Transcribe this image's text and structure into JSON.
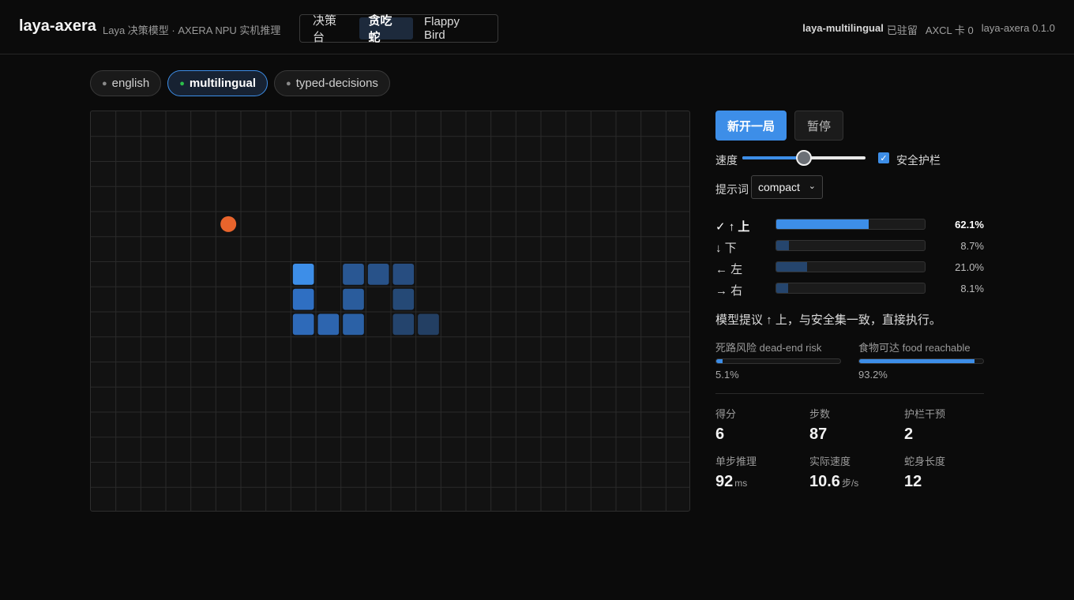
{
  "header": {
    "brand": "laya-axera",
    "subtitle": "Laya 决策模型 · AXERA NPU 实机推理",
    "tabs": [
      {
        "label": "决策台",
        "active": false
      },
      {
        "label": "贪吃蛇",
        "active": true
      },
      {
        "label": "Flappy Bird",
        "active": false
      }
    ],
    "status": {
      "model": "laya-multilingual",
      "model_state": "已驻留",
      "card": "AXCL 卡 0",
      "version": "laya-axera 0.1.0"
    }
  },
  "models": [
    {
      "label": "english",
      "active": false
    },
    {
      "label": "multilingual",
      "active": true
    },
    {
      "label": "typed-decisions",
      "active": false
    }
  ],
  "board": {
    "cols": 24,
    "rows": 16,
    "food": {
      "col": 5,
      "row": 4
    },
    "head": {
      "col": 8,
      "row": 6
    },
    "body": [
      {
        "col": 8,
        "row": 7
      },
      {
        "col": 8,
        "row": 8
      },
      {
        "col": 9,
        "row": 8
      },
      {
        "col": 10,
        "row": 8
      },
      {
        "col": 10,
        "row": 7
      },
      {
        "col": 10,
        "row": 6
      },
      {
        "col": 11,
        "row": 6
      },
      {
        "col": 12,
        "row": 6
      },
      {
        "col": 12,
        "row": 7
      },
      {
        "col": 12,
        "row": 8
      },
      {
        "col": 13,
        "row": 8
      }
    ],
    "colors": {
      "background": "#121212",
      "grid": "#2a2a2a",
      "food": "#e8642c",
      "head": "#3d8ee8",
      "body_near": "#2f6fc2",
      "body_far": "#233f63"
    }
  },
  "controls": {
    "new_game_label": "新开一局",
    "pause_label": "暂停",
    "speed_label": "速度",
    "speed_value": 0.5,
    "guard_label": "安全护栏",
    "guard_checked": true,
    "prompt_label": "提示词",
    "prompt_value": "compact"
  },
  "probabilities": [
    {
      "label": "✓ ↑ 上",
      "value": 0.621,
      "display": "62.1%",
      "best": true
    },
    {
      "label": "↓ 下",
      "value": 0.087,
      "display": "8.7%",
      "best": false
    },
    {
      "label": "← 左",
      "value": 0.21,
      "display": "21.0%",
      "best": false
    },
    {
      "label": "→ 右",
      "value": 0.081,
      "display": "8.1%",
      "best": false
    }
  ],
  "suggestion": "模型提议 ↑ 上，与安全集一致，直接执行。",
  "meters": {
    "deadend": {
      "label": "死路风险 dead-end risk",
      "value": 0.051,
      "display": "5.1%"
    },
    "food": {
      "label": "食物可达 food reachable",
      "value": 0.932,
      "display": "93.2%"
    }
  },
  "stats": {
    "score": {
      "label": "得分",
      "value": "6"
    },
    "steps": {
      "label": "步数",
      "value": "87"
    },
    "interventions": {
      "label": "护栏干预",
      "value": "2"
    },
    "latency": {
      "label": "单步推理",
      "value": "92",
      "unit": "ms"
    },
    "speed": {
      "label": "实际速度",
      "value": "10.6",
      "unit": "步/s"
    },
    "length": {
      "label": "蛇身长度",
      "value": "12"
    }
  }
}
